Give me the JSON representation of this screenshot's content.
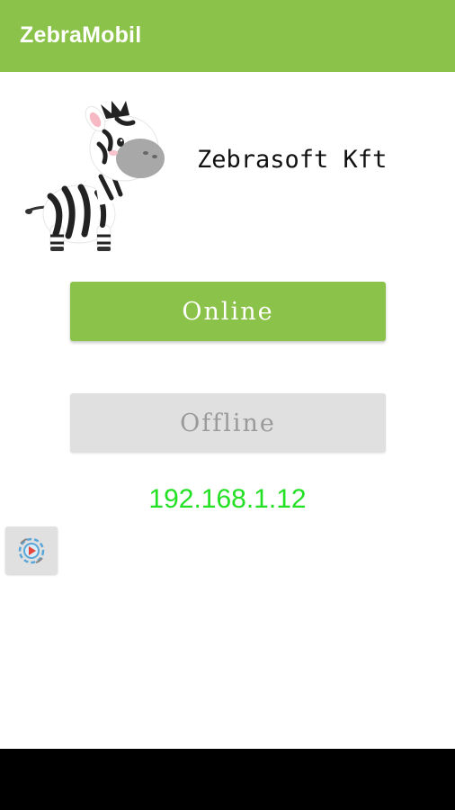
{
  "app": {
    "title": "ZebraMobil",
    "accent_color": "#8bc34a"
  },
  "header": {
    "company_name": "Zebrasoft Kft",
    "logo_icon": "zebra-icon"
  },
  "buttons": {
    "online_label": "Online",
    "offline_label": "Offline"
  },
  "status": {
    "ip_address": "192.168.1.12",
    "ip_color": "#22e022"
  },
  "settings": {
    "icon": "gear-icon"
  }
}
